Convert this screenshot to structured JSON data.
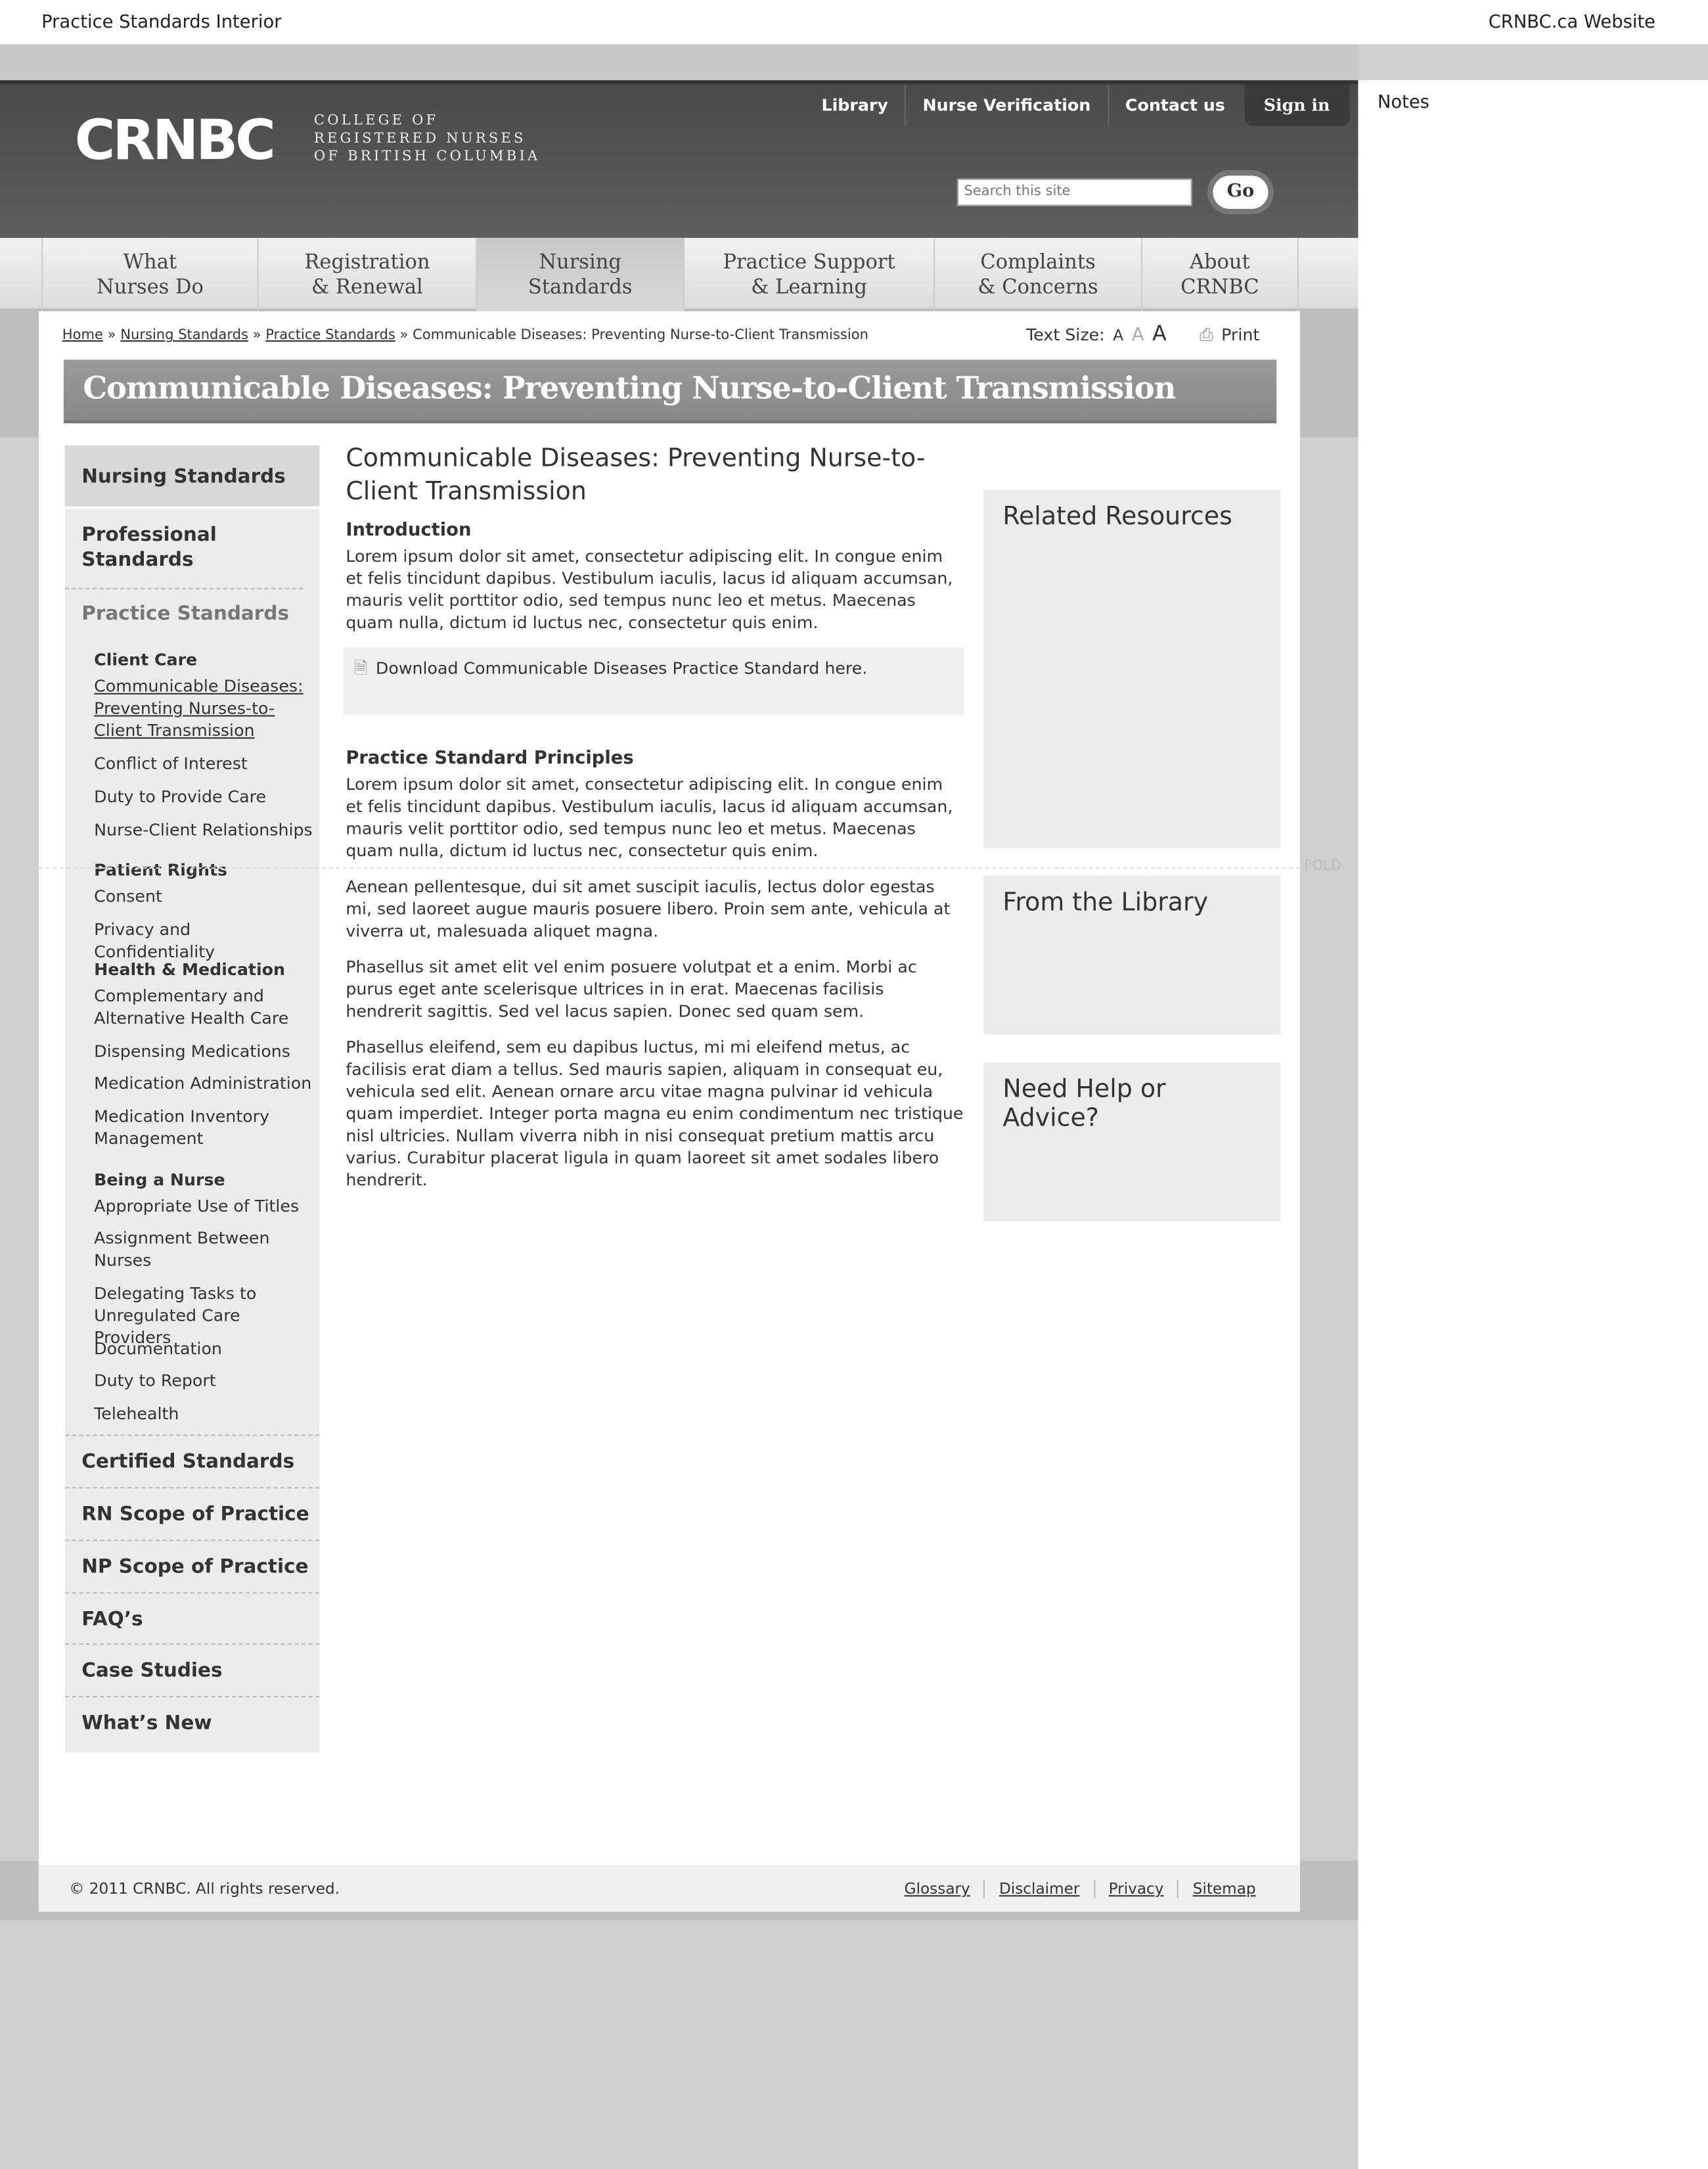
{
  "window": {
    "title": "Practice Standards Interior",
    "link": "CRNBC.ca Website"
  },
  "notes": {
    "title": "Notes"
  },
  "header": {
    "logo": "CRNBC",
    "logo_sub": [
      "COLLEGE OF",
      "REGISTERED NURSES",
      "OF BRITISH COLUMBIA"
    ],
    "utility": [
      "Library",
      "Nurse Verification",
      "Contact us"
    ],
    "sign_in": "Sign in",
    "search_placeholder": "Search this site",
    "go": "Go"
  },
  "nav": [
    {
      "l1": "What",
      "l2": "Nurses Do"
    },
    {
      "l1": "Registration",
      "l2": "& Renewal"
    },
    {
      "l1": "Nursing",
      "l2": "Standards"
    },
    {
      "l1": "Practice Support",
      "l2": "& Learning"
    },
    {
      "l1": "Complaints",
      "l2": "& Concerns"
    },
    {
      "l1": "About",
      "l2": "CRNBC"
    }
  ],
  "breadcrumb": {
    "items": [
      "Home",
      "Nursing Standards",
      "Practice Standards"
    ],
    "current": "Communicable Diseases: Preventing Nurse-to-Client Transmission",
    "sep": "»"
  },
  "tools": {
    "text_size": "Text Size:",
    "a": "A",
    "print": "Print"
  },
  "page_title": "Communicable Diseases: Preventing Nurse-to-Client Transmission",
  "sidebar": {
    "header": "Nursing Standards",
    "professional": "Professional Standards",
    "practice": "Practice Standards",
    "groups": [
      {
        "title": "Client Care",
        "items": [
          "Communicable Diseases: Preventing Nurses-to-Client Transmission",
          "Conflict of Interest",
          "Duty to Provide Care",
          "Nurse-Client Relationships"
        ]
      },
      {
        "title": "Patient Rights",
        "items": [
          "Consent",
          "Privacy and Confidentiality"
        ]
      },
      {
        "title": "Health & Medication",
        "items": [
          "Complementary and Alternative Health Care",
          "Dispensing Medications",
          "Medication Administration",
          "Medication Inventory Management"
        ]
      },
      {
        "title": "Being a Nurse",
        "items": [
          "Appropriate Use of Titles",
          "Assignment Between Nurses",
          "Delegating Tasks to Unregulated Care Providers",
          "Documentation",
          "Duty to Report",
          "Telehealth"
        ]
      }
    ],
    "bottom": [
      "Certified Standards",
      "RN Scope of Practice",
      "NP Scope of Practice",
      "FAQ’s",
      "Case Studies",
      "What’s New"
    ]
  },
  "content": {
    "title": "Communicable Diseases: Preventing Nurse-to-Client Transmission",
    "intro_h": "Introduction",
    "intro": "Lorem ipsum dolor sit amet, consectetur adipiscing elit. In congue enim et felis tincidunt dapibus. Vestibulum iaculis, lacus id aliquam accumsan, mauris velit porttitor odio, sed tempus nunc leo et metus. Maecenas quam nulla, dictum id luctus nec, consectetur quis enim.",
    "download": "Download Communicable Diseases Practice Standard here.",
    "principles_h": "Practice Standard Principles",
    "p1": "Lorem ipsum dolor sit amet, consectetur adipiscing elit. In congue enim et felis tincidunt dapibus. Vestibulum iaculis, lacus id aliquam accumsan, mauris velit porttitor odio, sed tempus nunc leo et metus. Maecenas quam nulla, dictum id luctus nec, consectetur quis enim.",
    "p2": "Aenean pellentesque, dui sit amet suscipit iaculis, lectus dolor egestas mi, sed laoreet augue mauris posuere libero. Proin sem ante, vehicula at viverra ut, malesuada aliquet magna.",
    "p3": "Phasellus sit amet elit vel enim posuere volutpat et a enim. Morbi ac purus eget ante scelerisque ultrices in in erat. Maecenas facilisis hendrerit sagittis. Sed vel lacus sapien. Donec sed quam sem.",
    "p4": "Phasellus eleifend, sem eu dapibus luctus, mi mi eleifend metus, ac facilisis erat diam a tellus. Sed mauris sapien, aliquam in consequat eu, vehicula sed elit. Aenean ornare arcu vitae magna pulvinar id vehicula quam imperdiet. Integer porta magna eu enim condimentum nec tristique nisl ultricies. Nullam viverra nibh in nisi consequat pretium mattis arcu varius. Curabitur placerat ligula in quam laoreet sit amet sodales libero hendrerit."
  },
  "right": [
    "Related Resources",
    "From the Library",
    "Need Help or Advice?"
  ],
  "fold": "FOLD",
  "footer": {
    "copyright": "© 2011 CRNBC. All rights reserved.",
    "links": [
      "Glossary",
      "Disclaimer",
      "Privacy",
      "Sitemap"
    ]
  }
}
